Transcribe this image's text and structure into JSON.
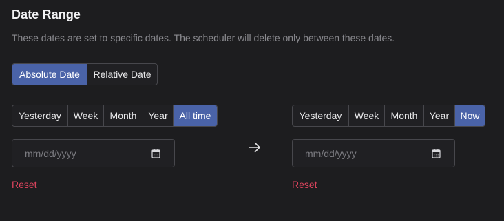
{
  "section": {
    "title": "Date Range",
    "description": "These dates are set to specific dates. The scheduler will delete only between these dates."
  },
  "mode_toggle": {
    "absolute": "Absolute Date",
    "relative": "Relative Date",
    "selected": "Absolute Date"
  },
  "start": {
    "presets": [
      "Yesterday",
      "Week",
      "Month",
      "Year",
      "All time"
    ],
    "selected": "All time",
    "date_placeholder": "mm/dd/yyyy",
    "reset_label": "Reset"
  },
  "end": {
    "presets": [
      "Yesterday",
      "Week",
      "Month",
      "Year",
      "Now"
    ],
    "selected": "Now",
    "date_placeholder": "mm/dd/yyyy",
    "reset_label": "Reset"
  },
  "icons": {
    "arrow": "arrow-right-icon",
    "calendar": "calendar-icon"
  },
  "colors": {
    "background": "#1d1d1f",
    "accent": "#4a63a8",
    "danger": "#e0445e",
    "border": "#47474c"
  }
}
